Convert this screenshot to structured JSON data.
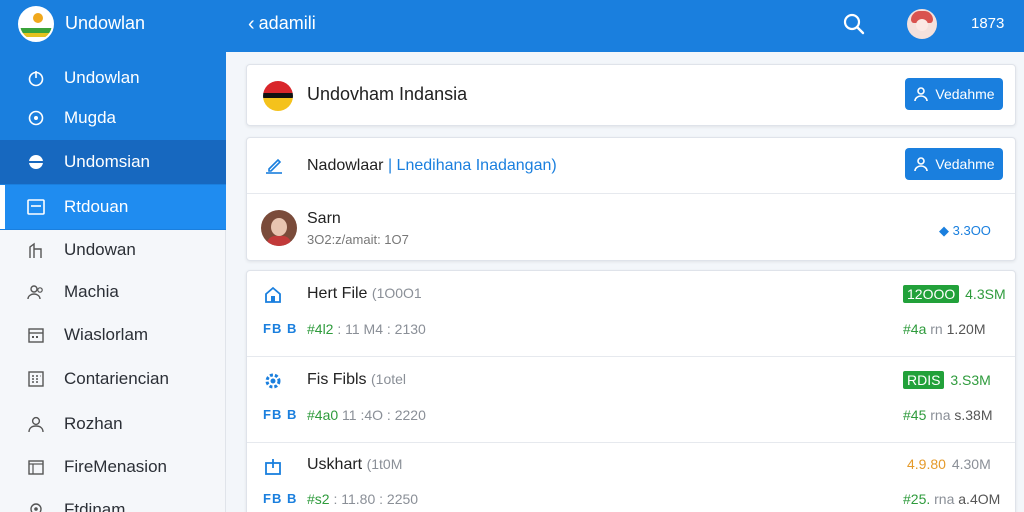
{
  "header": {
    "app_title": "Undowlan",
    "back_label": "adamili",
    "count": "1873"
  },
  "sidebar": {
    "items": [
      {
        "label": "Undowlan",
        "icon": "power-icon"
      },
      {
        "label": "Mugda",
        "icon": "settings-icon"
      },
      {
        "label": "Undomsian",
        "icon": "globe-icon"
      },
      {
        "label": "Rtdouan",
        "icon": "card-icon"
      },
      {
        "label": "Undowan",
        "icon": "building-icon"
      },
      {
        "label": "Machia",
        "icon": "users-icon"
      },
      {
        "label": "Wiaslorlam",
        "icon": "calendar-icon"
      },
      {
        "label": "Contariencian",
        "icon": "grid-icon"
      },
      {
        "label": "Rozhan",
        "icon": "user-icon"
      },
      {
        "label": "FireMenasion",
        "icon": "folder-icon"
      },
      {
        "label": "Ftdinam",
        "icon": "pin-icon"
      }
    ]
  },
  "card1": {
    "title": "Undovham Indansia",
    "button": "Vedahme"
  },
  "card2": {
    "title_main": "Nadowlaar",
    "title_link": "| Lnedihana Inadangan)",
    "button": "Vedahme",
    "user_name": "Sarn",
    "user_meta": "3O2:z/amait: 1O7",
    "user_value": "3.3OO"
  },
  "files": [
    {
      "name": "Hert File",
      "tag": "(1O0O1",
      "meta_code": "#4l2",
      "meta_time": ": 11 M4 : 2130",
      "badge": "12OOO",
      "size": "4.3SM",
      "sub_a": "#4a",
      "sub_b": "rn",
      "sub_c": "1.20M"
    },
    {
      "name": "Fis Fibls",
      "tag": "(1otel",
      "meta_code": "#4a0",
      "meta_time": "11 :4O : 2220",
      "badge": "RDIS",
      "size": "3.S3M",
      "sub_a": "#45",
      "sub_b": "rna",
      "sub_c": "s.38M"
    },
    {
      "name": "Uskhart",
      "tag": "(1t0M",
      "meta_code": "#s2",
      "meta_time": ": 11.80 : 2250",
      "badge": "4.9.80",
      "size": "4.30M",
      "sub_a": "#25.",
      "sub_b": "rna",
      "sub_c": "a.4OM"
    }
  ],
  "colors": {
    "primary": "#1a7fde",
    "sidebar_selected": "#1f8cf0",
    "success": "#22a13a",
    "warning": "#e59a2a"
  }
}
